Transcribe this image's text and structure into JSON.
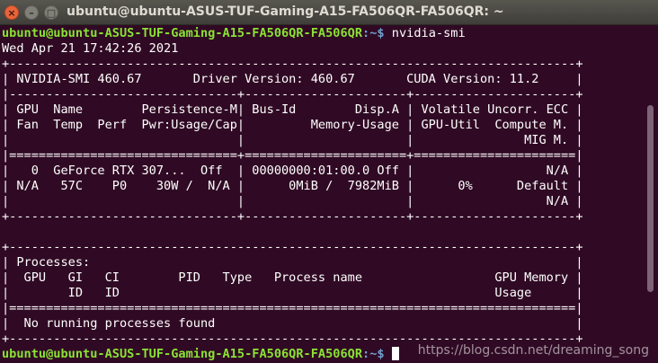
{
  "window": {
    "title": "ubuntu@ubuntu-ASUS-TUF-Gaming-A15-FA506QR-FA506QR: ~",
    "close_glyph": "×",
    "min_glyph": "–",
    "max_glyph": "□"
  },
  "prompt": {
    "user_host": "ubuntu@ubuntu-ASUS-TUF-Gaming-A15-FA506QR-FA506QR",
    "path_sep": ":~$ ",
    "command": "nvidia-smi"
  },
  "output": {
    "date": "Wed Apr 21 17:42:26 2021",
    "lines": [
      "+-----------------------------------------------------------------------------+",
      "| NVIDIA-SMI 460.67       Driver Version: 460.67       CUDA Version: 11.2     |",
      "|-------------------------------+----------------------+----------------------+",
      "| GPU  Name        Persistence-M| Bus-Id        Disp.A | Volatile Uncorr. ECC |",
      "| Fan  Temp  Perf  Pwr:Usage/Cap|         Memory-Usage | GPU-Util  Compute M. |",
      "|                               |                      |               MIG M. |",
      "|===============================+======================+======================|",
      "|   0  GeForce RTX 307...  Off  | 00000000:01:00.0 Off |                  N/A |",
      "| N/A   57C    P0    30W /  N/A |      0MiB /  7982MiB |      0%      Default |",
      "|                               |                      |                  N/A |",
      "+-------------------------------+----------------------+----------------------+",
      "",
      "+-----------------------------------------------------------------------------+",
      "| Processes:                                                                  |",
      "|  GPU   GI   CI        PID   Type   Process name                  GPU Memory |",
      "|        ID   ID                                                   Usage      |",
      "|=============================================================================|",
      "|  No running processes found                                                 |",
      "+-----------------------------------------------------------------------------+"
    ]
  },
  "final_prompt": {
    "user_host": "ubuntu@ubuntu-ASUS-TUF-Gaming-A15-FA506QR-FA506QR",
    "path_sep": ":~$ "
  },
  "watermark": "https://blog.csdn.net/dreaming_song"
}
